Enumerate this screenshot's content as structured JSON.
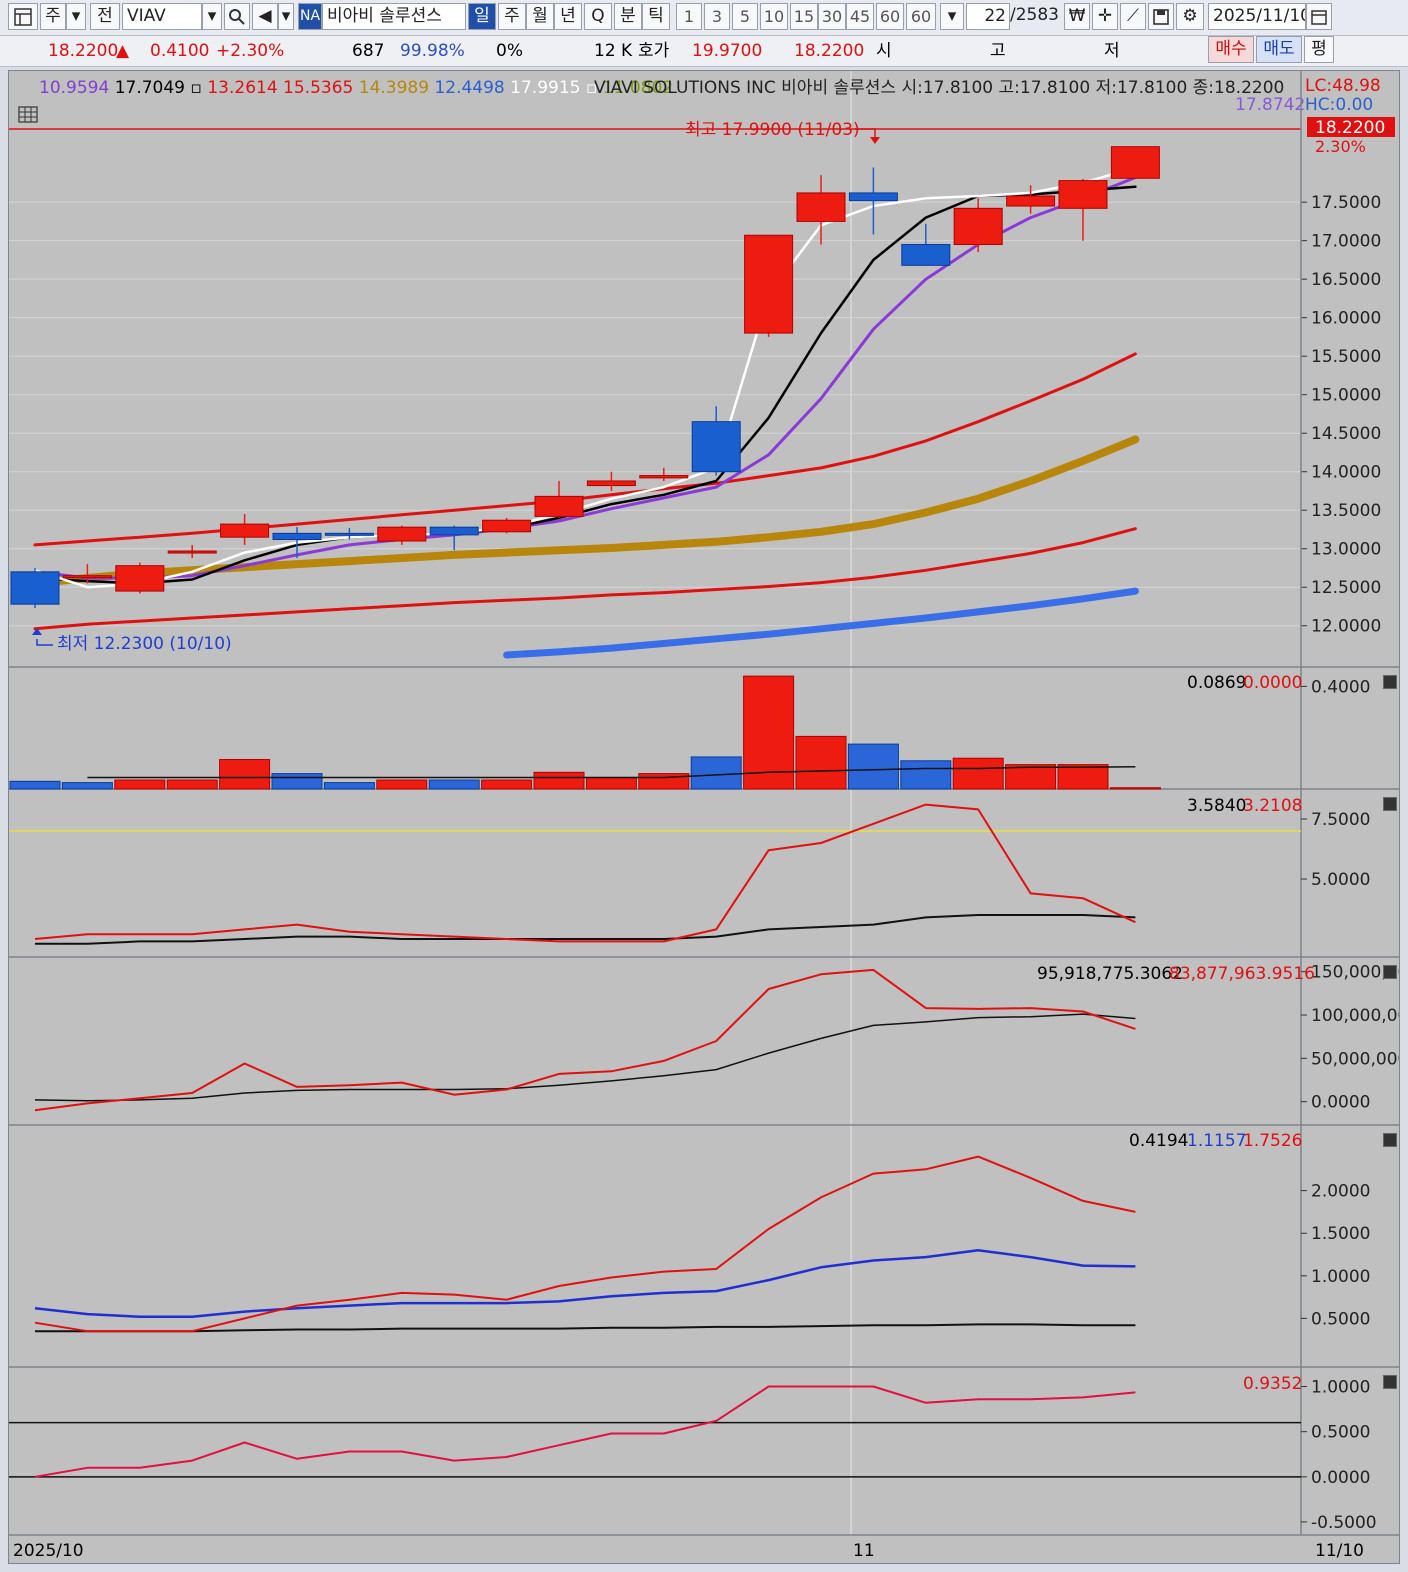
{
  "toolbar": {
    "market_label": "주",
    "prev_label": "전",
    "symbol": "VIAV",
    "na_badge": "NA",
    "stock_name": "비아비 솔루션스",
    "periods": [
      "일",
      "주",
      "월",
      "년",
      "Q",
      "분",
      "틱"
    ],
    "active_period": "일",
    "intervals": [
      "1",
      "3",
      "5",
      "10",
      "15",
      "30",
      "45",
      "60",
      "60"
    ],
    "count_value": "22",
    "count_total": "/2583",
    "date": "2025/11/10"
  },
  "infobar": {
    "price": "18.2200",
    "change_arrow": "▲",
    "change": "0.4100",
    "change_pct": "+2.30%",
    "volume": "687",
    "ratio": "99.98%",
    "zero_pct": "0%",
    "k_label": "12 K",
    "quote_label": "호가",
    "ask": "19.9700",
    "bid": "18.2200",
    "open_label": "시",
    "high_label": "고",
    "low_label": "저",
    "buy_label": "매수",
    "sell_label": "매도",
    "eval_label": "평"
  },
  "price_panel": {
    "ma_values": [
      {
        "text": "10.9594",
        "color": "#8040d0"
      },
      {
        "text": "17.7049",
        "color": "#000000"
      },
      {
        "text": "13.2614",
        "color": "#e01010"
      },
      {
        "text": "15.5365",
        "color": "#e01010"
      },
      {
        "text": "14.3989",
        "color": "#b8860b"
      },
      {
        "text": "12.4498",
        "color": "#2b5fd0"
      },
      {
        "text": "17.9915",
        "color": "#ffffff"
      },
      {
        "text": "11.0802",
        "color": "#7a9a10"
      }
    ],
    "title": "VIAVI SOLUTIONS INC  비아비 솔루션스 시:17.8100 고:17.8100 저:17.8100 종:18.2200",
    "lc": "LC:48.98",
    "hc": "HC:0.00",
    "ref_value": "17.8742",
    "current_price": "18.2200",
    "current_pct": "2.30%",
    "high_annotation": "최고 17.9900 (11/03)",
    "low_annotation": "최저 12.2300 (10/10)",
    "axis_ticks": [
      "17.5000",
      "17.0000",
      "16.5000",
      "16.0000",
      "15.5000",
      "15.0000",
      "14.5000",
      "14.0000",
      "13.5000",
      "13.0000",
      "12.5000",
      "12.0000"
    ]
  },
  "volume_panel": {
    "value1": "0.0869",
    "value2": "0.0000",
    "axis_ticks": [
      "0.4000"
    ]
  },
  "osc1_panel": {
    "value1": "3.5840",
    "value2": "3.2108",
    "axis_ticks": [
      "7.5000",
      "5.0000"
    ]
  },
  "osc2_panel": {
    "value1": "95,918,775.3062",
    "value2": "83,877,963.9516",
    "axis_ticks": [
      "150,000,00",
      "100,000,00",
      "50,000,000",
      "0.0000"
    ]
  },
  "osc3_panel": {
    "value1": "0.4194",
    "value2": "1.1157",
    "value3": "1.7526",
    "axis_ticks": [
      "2.0000",
      "1.5000",
      "1.0000",
      "0.5000"
    ]
  },
  "osc4_panel": {
    "value1": "0.9352",
    "axis_ticks": [
      "1.0000",
      "0.5000",
      "0.0000",
      "-0.5000"
    ]
  },
  "x_axis": {
    "labels": [
      "2025/10",
      "11",
      "11/10"
    ]
  },
  "chart_data": {
    "type": "candlestick",
    "title": "VIAVI SOLUTIONS INC  비아비 솔루션스",
    "ylim": [
      11.75,
      18.45
    ],
    "candles": [
      {
        "o": 12.7,
        "h": 12.75,
        "l": 12.23,
        "c": 12.28
      },
      {
        "o": 12.65,
        "h": 12.8,
        "l": 12.55,
        "c": 12.65
      },
      {
        "o": 12.45,
        "h": 12.82,
        "l": 12.42,
        "c": 12.78
      },
      {
        "o": 12.95,
        "h": 13.05,
        "l": 12.88,
        "c": 12.97
      },
      {
        "o": 13.15,
        "h": 13.45,
        "l": 13.05,
        "c": 13.32
      },
      {
        "o": 13.2,
        "h": 13.28,
        "l": 12.88,
        "c": 13.12
      },
      {
        "o": 13.2,
        "h": 13.27,
        "l": 13.12,
        "c": 13.18
      },
      {
        "o": 13.1,
        "h": 13.3,
        "l": 13.05,
        "c": 13.28
      },
      {
        "o": 13.28,
        "h": 13.3,
        "l": 12.98,
        "c": 13.18
      },
      {
        "o": 13.22,
        "h": 13.4,
        "l": 13.2,
        "c": 13.37
      },
      {
        "o": 13.42,
        "h": 13.88,
        "l": 13.4,
        "c": 13.68
      },
      {
        "o": 13.82,
        "h": 14.0,
        "l": 13.75,
        "c": 13.88
      },
      {
        "o": 13.92,
        "h": 14.05,
        "l": 13.88,
        "c": 13.95
      },
      {
        "o": 14.65,
        "h": 14.85,
        "l": 13.95,
        "c": 14.0
      },
      {
        "o": 15.8,
        "h": 16.45,
        "l": 15.75,
        "c": 17.07
      },
      {
        "o": 17.25,
        "h": 17.85,
        "l": 16.95,
        "c": 17.62
      },
      {
        "o": 17.62,
        "h": 17.95,
        "l": 17.08,
        "c": 17.52
      },
      {
        "o": 16.95,
        "h": 17.22,
        "l": 16.75,
        "c": 16.68
      },
      {
        "o": 16.95,
        "h": 17.55,
        "l": 16.85,
        "c": 17.42
      },
      {
        "o": 17.45,
        "h": 17.72,
        "l": 17.35,
        "c": 17.58
      },
      {
        "o": 17.42,
        "h": 17.8,
        "l": 17.0,
        "c": 17.78
      },
      {
        "o": 17.81,
        "h": 17.81,
        "l": 17.81,
        "c": 18.22
      }
    ],
    "series": [
      {
        "name": "17.9915",
        "color": "#ffffff",
        "values": [
          12.72,
          12.5,
          12.55,
          12.7,
          12.95,
          13.08,
          13.15,
          13.18,
          13.2,
          13.28,
          13.45,
          13.65,
          13.8,
          14.05,
          16.3,
          17.2,
          17.45,
          17.55,
          17.58,
          17.62,
          17.75,
          17.95
        ]
      },
      {
        "name": "17.7049",
        "color": "#000000",
        "values": [
          12.62,
          12.58,
          12.55,
          12.6,
          12.85,
          13.05,
          13.15,
          13.18,
          13.2,
          13.26,
          13.4,
          13.58,
          13.7,
          13.88,
          14.7,
          15.8,
          16.75,
          17.3,
          17.58,
          17.6,
          17.65,
          17.7
        ]
      },
      {
        "name": "10.9594",
        "color": "#8a3ad6",
        "values": [
          12.7,
          12.62,
          12.62,
          12.65,
          12.78,
          12.92,
          13.05,
          13.12,
          13.18,
          13.26,
          13.36,
          13.52,
          13.66,
          13.8,
          14.22,
          14.95,
          15.85,
          16.5,
          16.95,
          17.3,
          17.55,
          17.82
        ]
      },
      {
        "name": "15.5365",
        "color": "#e01010",
        "values": [
          13.05,
          13.1,
          13.15,
          13.2,
          13.26,
          13.32,
          13.38,
          13.44,
          13.5,
          13.56,
          13.62,
          13.7,
          13.78,
          13.85,
          13.95,
          14.05,
          14.2,
          14.4,
          14.65,
          14.92,
          15.2,
          15.53
        ]
      },
      {
        "name": "14.3989",
        "color": "#b8860b",
        "values": [
          12.55,
          12.62,
          12.68,
          12.72,
          12.76,
          12.8,
          12.84,
          12.88,
          12.92,
          12.95,
          12.98,
          13.01,
          13.05,
          13.09,
          13.15,
          13.22,
          13.32,
          13.47,
          13.65,
          13.88,
          14.14,
          14.42
        ]
      },
      {
        "name": "13.2614",
        "color": "#e01010",
        "values": [
          11.96,
          12.02,
          12.06,
          12.1,
          12.14,
          12.18,
          12.22,
          12.26,
          12.3,
          12.33,
          12.36,
          12.4,
          12.43,
          12.47,
          12.51,
          12.56,
          12.63,
          12.72,
          12.83,
          12.94,
          13.08,
          13.26
        ]
      },
      {
        "name": "12.4498",
        "color": "#3a6ee8",
        "values": [
          null,
          null,
          null,
          null,
          null,
          null,
          null,
          null,
          null,
          11.62,
          11.66,
          11.71,
          11.77,
          11.83,
          11.89,
          11.96,
          12.03,
          12.1,
          12.18,
          12.26,
          12.35,
          12.45
        ]
      }
    ],
    "volume": [
      0.03,
      0.025,
      0.035,
      0.035,
      0.115,
      0.06,
      0.025,
      0.035,
      0.035,
      0.035,
      0.065,
      0.045,
      0.06,
      0.125,
      0.44,
      0.205,
      0.175,
      0.11,
      0.12,
      0.095,
      0.095,
      0.005
    ],
    "volume_up": [
      false,
      false,
      true,
      true,
      true,
      false,
      false,
      true,
      false,
      true,
      true,
      true,
      true,
      false,
      true,
      true,
      false,
      false,
      true,
      true,
      true,
      true
    ],
    "volume_ma": [
      null,
      0.045,
      0.045,
      0.045,
      0.045,
      0.045,
      0.045,
      0.045,
      0.045,
      0.045,
      0.045,
      0.045,
      0.045,
      0.055,
      0.065,
      0.07,
      0.075,
      0.08,
      0.08,
      0.085,
      0.085,
      0.087
    ],
    "osc1": {
      "ylim": [
        2.0,
        8.5
      ],
      "red": [
        2.5,
        2.7,
        2.7,
        2.7,
        2.9,
        3.1,
        2.8,
        2.7,
        2.6,
        2.5,
        2.4,
        2.4,
        2.4,
        2.9,
        6.2,
        6.5,
        7.3,
        8.1,
        7.9,
        4.4,
        4.2,
        3.2
      ],
      "black": [
        2.3,
        2.3,
        2.4,
        2.4,
        2.5,
        2.6,
        2.6,
        2.5,
        2.5,
        2.5,
        2.5,
        2.5,
        2.5,
        2.6,
        2.9,
        3.0,
        3.1,
        3.4,
        3.5,
        3.5,
        3.5,
        3.4
      ],
      "hline": 7.0
    },
    "osc2": {
      "ylim": [
        -20000000,
        160000000
      ],
      "red": [
        -10000000,
        -2000000,
        4000000,
        10000000,
        44000000,
        17000000,
        19000000,
        22000000,
        8000000,
        14000000,
        32000000,
        35000000,
        47000000,
        70000000,
        130000000,
        147000000,
        152000000,
        108000000,
        107000000,
        108000000,
        104000000,
        84000000
      ],
      "black": [
        2000000,
        1000000,
        2000000,
        4000000,
        10000000,
        13000000,
        14000000,
        14000000,
        14000000,
        15000000,
        19000000,
        24000000,
        30000000,
        37000000,
        56000000,
        73000000,
        88000000,
        92000000,
        97000000,
        98000000,
        101000000,
        96000000
      ]
    },
    "osc3": {
      "ylim": [
        0.0,
        2.7
      ],
      "red": [
        0.45,
        0.35,
        0.35,
        0.35,
        0.5,
        0.65,
        0.72,
        0.8,
        0.78,
        0.72,
        0.88,
        0.98,
        1.05,
        1.08,
        1.55,
        1.92,
        2.2,
        2.25,
        2.4,
        2.15,
        1.88,
        1.75
      ],
      "blue": [
        0.62,
        0.55,
        0.52,
        0.52,
        0.58,
        0.62,
        0.65,
        0.68,
        0.68,
        0.68,
        0.7,
        0.76,
        0.8,
        0.82,
        0.95,
        1.1,
        1.18,
        1.22,
        1.3,
        1.22,
        1.12,
        1.11
      ],
      "black": [
        0.35,
        0.35,
        0.35,
        0.35,
        0.36,
        0.37,
        0.37,
        0.38,
        0.38,
        0.38,
        0.38,
        0.39,
        0.39,
        0.4,
        0.4,
        0.41,
        0.42,
        0.42,
        0.43,
        0.43,
        0.42,
        0.42
      ]
    },
    "osc4": {
      "ylim": [
        -0.6,
        1.15
      ],
      "red": [
        0.0,
        0.1,
        0.1,
        0.18,
        0.38,
        0.2,
        0.28,
        0.28,
        0.18,
        0.22,
        0.35,
        0.48,
        0.48,
        0.62,
        1.0,
        1.0,
        1.0,
        0.82,
        0.86,
        0.86,
        0.88,
        0.935
      ],
      "hlines": [
        0.6,
        0.0
      ]
    }
  }
}
